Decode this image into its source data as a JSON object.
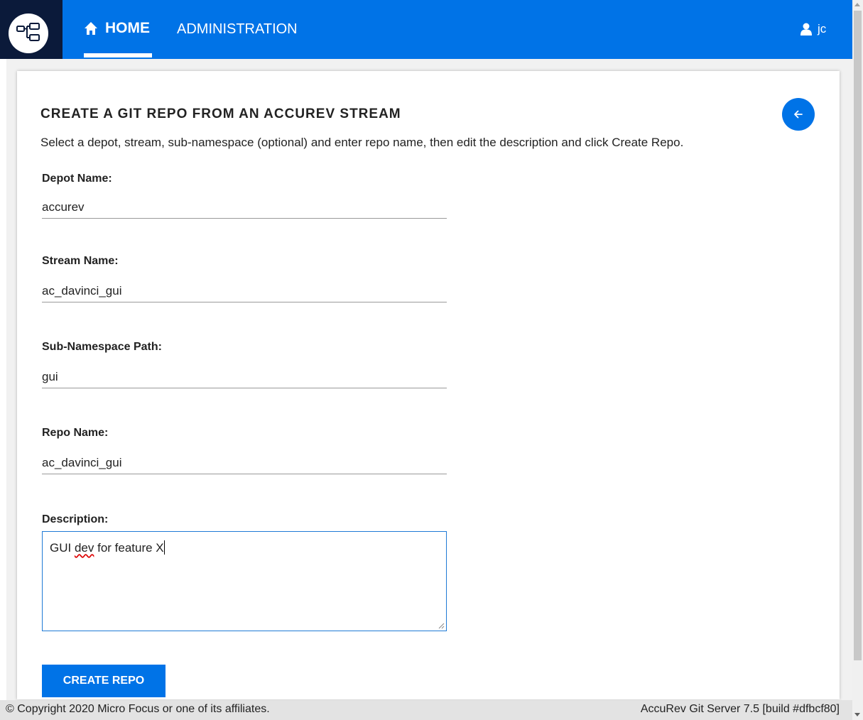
{
  "header": {
    "home_label": "HOME",
    "admin_label": "ADMINISTRATION",
    "user_name": "jc",
    "accent_color": "#0073e7"
  },
  "page": {
    "title": "CREATE A GIT REPO FROM AN ACCUREV STREAM",
    "instructions": "Select a depot, stream, sub-namespace (optional) and enter repo name, then edit the description and click Create Repo."
  },
  "form": {
    "depot_label": "Depot Name:",
    "depot_value": "accurev",
    "stream_label": "Stream Name:",
    "stream_value": "ac_davinci_gui",
    "subns_label": "Sub-Namespace Path:",
    "subns_value": "gui",
    "repo_label": "Repo Name:",
    "repo_value": "ac_davinci_gui",
    "desc_label": "Description:",
    "desc_before": "GUI ",
    "desc_misspelled": "dev",
    "desc_after": " for feature X",
    "create_label": "CREATE REPO"
  },
  "footer": {
    "copyright": "© Copyright 2020 Micro Focus or one of its affiliates.",
    "version": "AccuRev Git Server 7.5 [build #dfbcf80]"
  },
  "icons": {
    "logo": "repo-tree-icon",
    "home": "home-icon",
    "user": "user-icon",
    "back": "arrow-left-icon"
  }
}
